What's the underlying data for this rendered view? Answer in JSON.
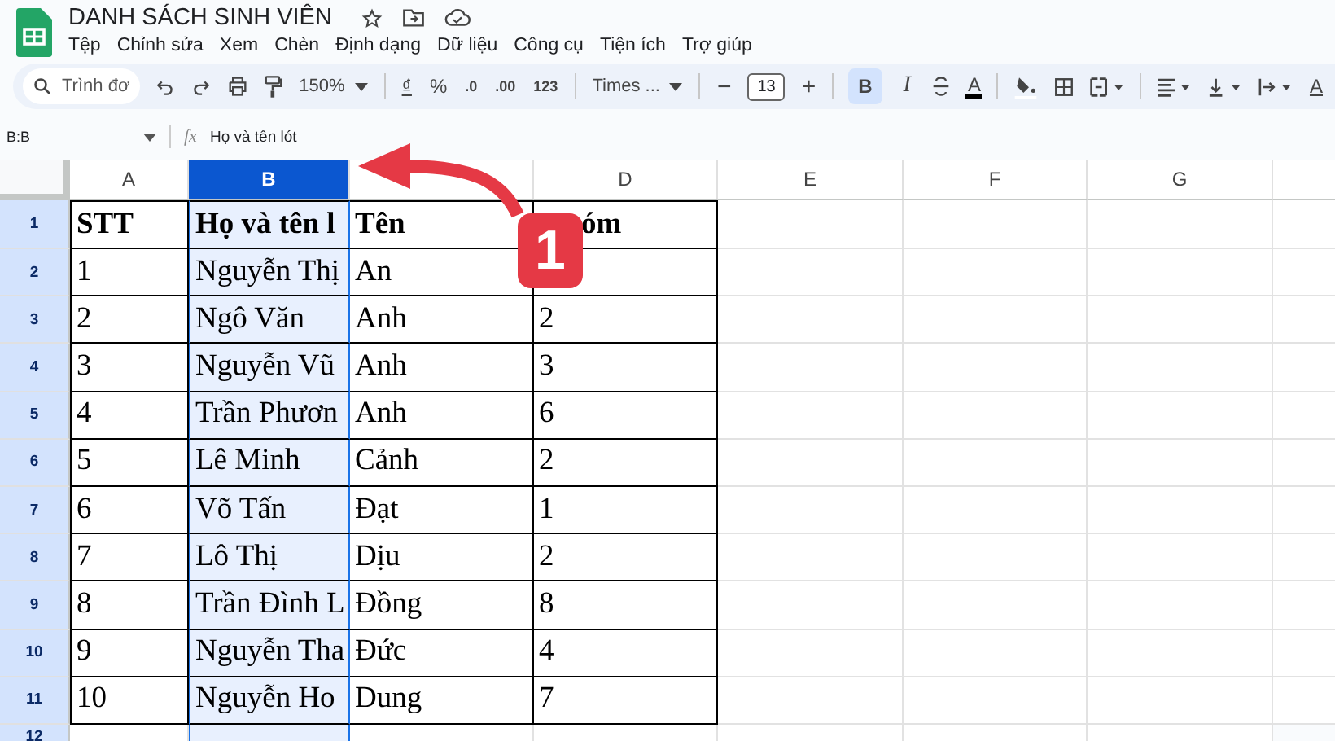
{
  "document": {
    "title": "DANH SÁCH SINH VIÊN"
  },
  "menu": [
    "Tệp",
    "Chỉnh sửa",
    "Xem",
    "Chèn",
    "Định dạng",
    "Dữ liệu",
    "Công cụ",
    "Tiện ích",
    "Trợ giúp"
  ],
  "toolbar": {
    "search_placeholder": "Trình đơ",
    "zoom": "150%",
    "currency": "₫",
    "percent": "%",
    "decrease_decimal": ".0",
    "increase_decimal": ".00",
    "number_format": "123",
    "font": "Times ...",
    "font_size": "13",
    "minus": "−",
    "plus": "+",
    "bold": {
      "label": "B",
      "selected": true
    },
    "italic": {
      "label": "I",
      "selected": false
    },
    "text_color": "A",
    "text_style": "A"
  },
  "formula_bar": {
    "name_box": "B:B",
    "fx": "fx",
    "value": "Họ và tên lót"
  },
  "table": {
    "columns": [
      {
        "label": "A",
        "selected": false
      },
      {
        "label": "B",
        "selected": true
      },
      {
        "selected": false
      },
      {
        "label": "D",
        "selected": false
      },
      {
        "label": "E",
        "selected": false
      },
      {
        "label": "F",
        "selected": false
      },
      {
        "label": "G",
        "selected": false
      }
    ],
    "rows": [
      {
        "number": "1",
        "cells": [
          "STT",
          "Họ và tên l",
          "Tên",
          "óm"
        ]
      },
      {
        "number": "2",
        "cells": [
          "1",
          "Nguyễn Thị",
          "An",
          ""
        ]
      },
      {
        "number": "3",
        "cells": [
          "2",
          "Ngô Văn",
          "Anh",
          "2"
        ]
      },
      {
        "number": "4",
        "cells": [
          "3",
          "Nguyễn Vũ",
          "Anh",
          "3"
        ]
      },
      {
        "number": "5",
        "cells": [
          "4",
          "Trần Phươn",
          "Anh",
          "6"
        ]
      },
      {
        "number": "6",
        "cells": [
          "5",
          "Lê Minh",
          "Cảnh",
          "2"
        ]
      },
      {
        "number": "7",
        "cells": [
          "6",
          "Võ Tấn",
          "Đạt",
          "1"
        ]
      },
      {
        "number": "8",
        "cells": [
          "7",
          "Lô Thị",
          "Dịu",
          "2"
        ]
      },
      {
        "number": "9",
        "cells": [
          "8",
          "Trần Đình L",
          "Đồng",
          "8"
        ]
      },
      {
        "number": "10",
        "cells": [
          "9",
          "Nguyễn Tha",
          "Đức",
          "4"
        ]
      },
      {
        "number": "11",
        "cells": [
          "10",
          "Nguyễn Ho",
          "Dung",
          "7"
        ]
      },
      {
        "number": "12",
        "cells": []
      }
    ]
  },
  "annotation": {
    "badge": "1"
  }
}
